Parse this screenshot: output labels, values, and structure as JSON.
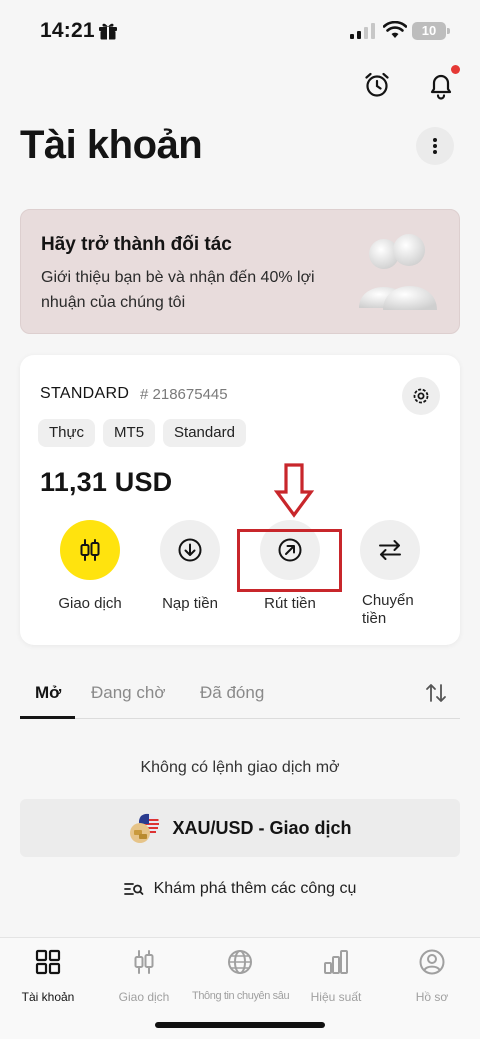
{
  "status_bar": {
    "time": "14:21",
    "battery": "10"
  },
  "header": {
    "title": "Tài khoản"
  },
  "partner_banner": {
    "title": "Hãy trở thành đối tác",
    "description": "Giới thiệu bạn bè và nhận đến 40% lợi nhuận của chúng tôi"
  },
  "account": {
    "type": "STANDARD",
    "number": "# 218675445",
    "tags": [
      "Thực",
      "MT5",
      "Standard"
    ],
    "balance": "11,31 USD",
    "actions": [
      {
        "label": "Giao dịch",
        "icon": "candlestick-icon"
      },
      {
        "label": "Nạp tiền",
        "icon": "arrow-down-circle-icon"
      },
      {
        "label": "Rút tiền",
        "icon": "arrow-up-right-circle-icon"
      },
      {
        "label": "Chuyển tiền",
        "label_line1": "Chuyển",
        "label_line2": "tiền",
        "icon": "swap-arrows-icon"
      }
    ]
  },
  "tabs": {
    "items": [
      "Mở",
      "Đang chờ",
      "Đã đóng"
    ],
    "active": "Mở"
  },
  "empty_state": "Không có lệnh giao dịch mở",
  "instrument_button": "XAU/USD - Giao dịch",
  "explore_link": "Khám phá thêm các công cụ",
  "bottom_nav": {
    "items": [
      "Tài khoản",
      "Giao dịch",
      "Thông tin chuyên sâu",
      "Hiệu suất",
      "Hồ sơ"
    ],
    "active": "Tài khoản"
  },
  "colors": {
    "accent_yellow": "#ffe30e",
    "banner_bg": "#e8dcdc",
    "annotation_red": "#c8262b",
    "notification_dot": "#e53935"
  }
}
